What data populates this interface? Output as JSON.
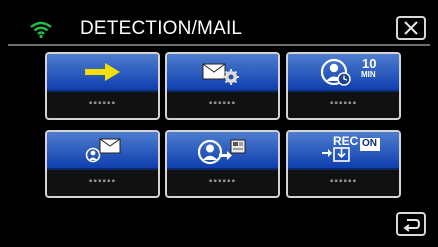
{
  "header": {
    "title": "DETECTION/MAIL",
    "wifi_icon": "wifi-icon",
    "close_icon": "close-icon"
  },
  "tiles": [
    {
      "icon": "arrow-right-icon",
      "label": "▪▪▪▪▪▪"
    },
    {
      "icon": "mail-settings-icon",
      "label": "▪▪▪▪▪▪"
    },
    {
      "icon": "user-timer-10-min-icon",
      "label": "▪▪▪▪▪▪",
      "badge_top": "10",
      "badge_bottom": "MIN"
    },
    {
      "icon": "mail-user-icon",
      "label": "▪▪▪▪▪▪"
    },
    {
      "icon": "user-image-icon",
      "label": "▪▪▪▪▪▪"
    },
    {
      "icon": "rec-on-icon",
      "label": "▪▪▪▪▪▪",
      "badge_top": "REC",
      "badge_right": "ON"
    }
  ],
  "footer": {
    "back_icon": "back-icon"
  },
  "colors": {
    "accent": "#1b4fb8",
    "arrow": "#f4e000",
    "wifi": "#22c04a"
  }
}
